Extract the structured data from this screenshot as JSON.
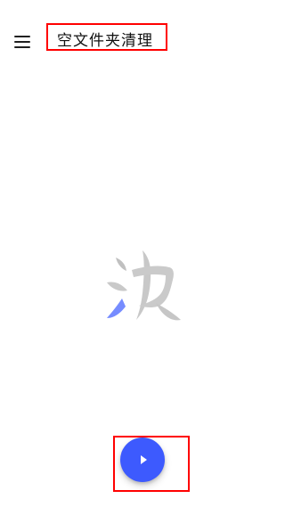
{
  "app_bar": {
    "title": "空文件夹清理"
  },
  "icons": {
    "menu": "hamburger-menu-icon",
    "play": "play-icon",
    "watermark": "ink-brush-watermark-icon"
  },
  "colors": {
    "background": "#ffffff",
    "title_text": "#111111",
    "highlight_box": "#ff0000",
    "fab": "#3d5afe",
    "fab_icon": "#ffffff",
    "watermark_gray": "#c8c8c8",
    "watermark_blue": "#6f86ff"
  }
}
